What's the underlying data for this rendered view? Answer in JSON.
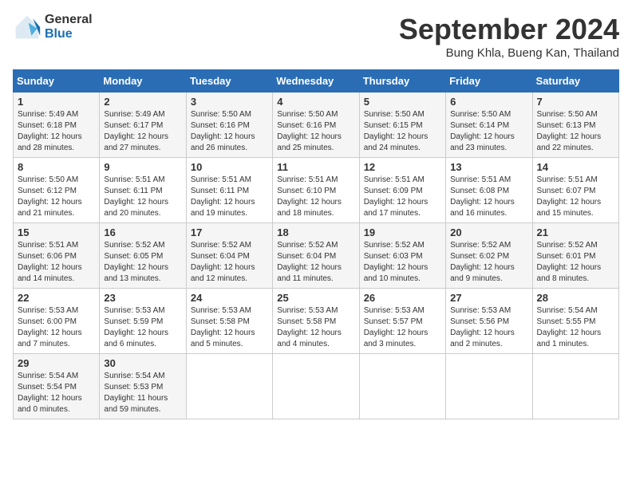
{
  "header": {
    "logo_general": "General",
    "logo_blue": "Blue",
    "month_title": "September 2024",
    "location": "Bung Khla, Bueng Kan, Thailand"
  },
  "weekdays": [
    "Sunday",
    "Monday",
    "Tuesday",
    "Wednesday",
    "Thursday",
    "Friday",
    "Saturday"
  ],
  "weeks": [
    [
      {
        "day": "1",
        "sunrise": "5:49 AM",
        "sunset": "6:18 PM",
        "daylight": "12 hours and 28 minutes."
      },
      {
        "day": "2",
        "sunrise": "5:49 AM",
        "sunset": "6:17 PM",
        "daylight": "12 hours and 27 minutes."
      },
      {
        "day": "3",
        "sunrise": "5:50 AM",
        "sunset": "6:16 PM",
        "daylight": "12 hours and 26 minutes."
      },
      {
        "day": "4",
        "sunrise": "5:50 AM",
        "sunset": "6:16 PM",
        "daylight": "12 hours and 25 minutes."
      },
      {
        "day": "5",
        "sunrise": "5:50 AM",
        "sunset": "6:15 PM",
        "daylight": "12 hours and 24 minutes."
      },
      {
        "day": "6",
        "sunrise": "5:50 AM",
        "sunset": "6:14 PM",
        "daylight": "12 hours and 23 minutes."
      },
      {
        "day": "7",
        "sunrise": "5:50 AM",
        "sunset": "6:13 PM",
        "daylight": "12 hours and 22 minutes."
      }
    ],
    [
      {
        "day": "8",
        "sunrise": "5:50 AM",
        "sunset": "6:12 PM",
        "daylight": "12 hours and 21 minutes."
      },
      {
        "day": "9",
        "sunrise": "5:51 AM",
        "sunset": "6:11 PM",
        "daylight": "12 hours and 20 minutes."
      },
      {
        "day": "10",
        "sunrise": "5:51 AM",
        "sunset": "6:11 PM",
        "daylight": "12 hours and 19 minutes."
      },
      {
        "day": "11",
        "sunrise": "5:51 AM",
        "sunset": "6:10 PM",
        "daylight": "12 hours and 18 minutes."
      },
      {
        "day": "12",
        "sunrise": "5:51 AM",
        "sunset": "6:09 PM",
        "daylight": "12 hours and 17 minutes."
      },
      {
        "day": "13",
        "sunrise": "5:51 AM",
        "sunset": "6:08 PM",
        "daylight": "12 hours and 16 minutes."
      },
      {
        "day": "14",
        "sunrise": "5:51 AM",
        "sunset": "6:07 PM",
        "daylight": "12 hours and 15 minutes."
      }
    ],
    [
      {
        "day": "15",
        "sunrise": "5:51 AM",
        "sunset": "6:06 PM",
        "daylight": "12 hours and 14 minutes."
      },
      {
        "day": "16",
        "sunrise": "5:52 AM",
        "sunset": "6:05 PM",
        "daylight": "12 hours and 13 minutes."
      },
      {
        "day": "17",
        "sunrise": "5:52 AM",
        "sunset": "6:04 PM",
        "daylight": "12 hours and 12 minutes."
      },
      {
        "day": "18",
        "sunrise": "5:52 AM",
        "sunset": "6:04 PM",
        "daylight": "12 hours and 11 minutes."
      },
      {
        "day": "19",
        "sunrise": "5:52 AM",
        "sunset": "6:03 PM",
        "daylight": "12 hours and 10 minutes."
      },
      {
        "day": "20",
        "sunrise": "5:52 AM",
        "sunset": "6:02 PM",
        "daylight": "12 hours and 9 minutes."
      },
      {
        "day": "21",
        "sunrise": "5:52 AM",
        "sunset": "6:01 PM",
        "daylight": "12 hours and 8 minutes."
      }
    ],
    [
      {
        "day": "22",
        "sunrise": "5:53 AM",
        "sunset": "6:00 PM",
        "daylight": "12 hours and 7 minutes."
      },
      {
        "day": "23",
        "sunrise": "5:53 AM",
        "sunset": "5:59 PM",
        "daylight": "12 hours and 6 minutes."
      },
      {
        "day": "24",
        "sunrise": "5:53 AM",
        "sunset": "5:58 PM",
        "daylight": "12 hours and 5 minutes."
      },
      {
        "day": "25",
        "sunrise": "5:53 AM",
        "sunset": "5:58 PM",
        "daylight": "12 hours and 4 minutes."
      },
      {
        "day": "26",
        "sunrise": "5:53 AM",
        "sunset": "5:57 PM",
        "daylight": "12 hours and 3 minutes."
      },
      {
        "day": "27",
        "sunrise": "5:53 AM",
        "sunset": "5:56 PM",
        "daylight": "12 hours and 2 minutes."
      },
      {
        "day": "28",
        "sunrise": "5:54 AM",
        "sunset": "5:55 PM",
        "daylight": "12 hours and 1 minute."
      }
    ],
    [
      {
        "day": "29",
        "sunrise": "5:54 AM",
        "sunset": "5:54 PM",
        "daylight": "12 hours and 0 minutes."
      },
      {
        "day": "30",
        "sunrise": "5:54 AM",
        "sunset": "5:53 PM",
        "daylight": "11 hours and 59 minutes."
      },
      null,
      null,
      null,
      null,
      null
    ]
  ]
}
